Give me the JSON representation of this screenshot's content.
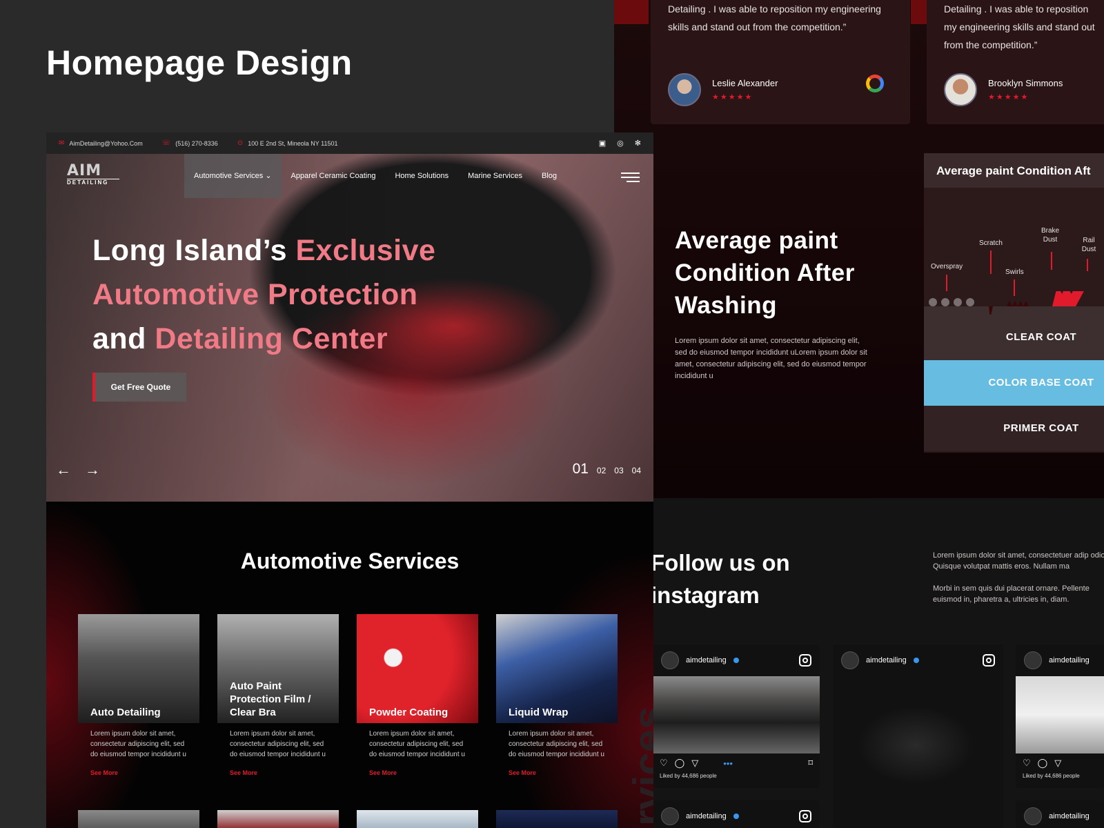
{
  "page_title": "Homepage Design",
  "testimonials": [
    {
      "quote": "Detailing . I was able to reposition my engineering skills and stand out from the competition.”",
      "name": "Leslie Alexander",
      "stars": "★★★★★"
    },
    {
      "quote": "Detailing . I was able to reposition my engineering skills and stand out from the competition.”",
      "name": "Brooklyn Simmons",
      "stars": "★★★★★"
    }
  ],
  "topbar": {
    "email": "AimDetailing@Yohoo.Com",
    "phone": "(516) 270-8336",
    "address": "100 E 2nd St, Mineola NY 11501"
  },
  "nav": {
    "logo_top": "AIM",
    "logo_bottom": "DETAILING",
    "items": [
      "Automotive Services",
      "Apparel Ceramic Coating",
      "Home Solutions",
      "Marine Services",
      "Blog"
    ]
  },
  "hero": {
    "line1_white": "Long Island’s ",
    "line1_pink": "Exclusive",
    "line2_pink": "Automotive Protection",
    "line3_white": "and ",
    "line3_pink": "Detailing Center",
    "cta": "Get Free Quote",
    "slides": [
      "01",
      "02",
      "03",
      "04"
    ]
  },
  "services": {
    "title": "Automotive Services",
    "vertical_text": "rvices",
    "cards": [
      {
        "name": "Auto Detailing",
        "desc": "Lorem ipsum dolor sit amet, consectetur adipiscing elit, sed do eiusmod tempor incididunt u",
        "more": "See More"
      },
      {
        "name": "Auto Paint Protection Film / Clear Bra",
        "desc": "Lorem ipsum dolor sit amet, consectetur adipiscing elit, sed do eiusmod tempor incididunt u",
        "more": "See More"
      },
      {
        "name": "Powder Coating",
        "desc": "Lorem ipsum dolor sit amet, consectetur adipiscing elit, sed do eiusmod tempor incididunt u",
        "more": "See More"
      },
      {
        "name": "Liquid Wrap",
        "desc": "Lorem ipsum dolor sit amet, consectetur adipiscing elit, sed do eiusmod tempor incididunt u",
        "more": "See More"
      }
    ]
  },
  "paint": {
    "title": "Average paint Condition After Washing",
    "desc": "Lorem ipsum dolor sit amet, consectetur adipiscing elit, sed do eiusmod tempor incididunt uLorem ipsum dolor sit amet, consectetur adipiscing elit, sed do eiusmod tempor incididunt u",
    "diagram_header": "Average paint  Condition  Aft",
    "labels": {
      "overspray": "Overspray",
      "scratch": "Scratch",
      "swirls": "Swirls",
      "brake": "Brake Dust",
      "rail": "Rail Dust"
    },
    "layers": {
      "clear": "CLEAR COAT",
      "color": "COLOR BASE COAT",
      "primer": "PRIMER COAT"
    }
  },
  "instagram": {
    "title": "Follow us on instagram",
    "desc1": "Lorem ipsum dolor sit amet, consectetuer adip odio. Quisque volutpat mattis eros. Nullam ma",
    "desc2": "Morbi in sem quis dui placerat ornare. Pellente euismod in, pharetra a, ultricies in, diam.",
    "handle": "aimdetailing",
    "liked": "Liked by 44,686 people"
  },
  "colors": {
    "accent": "#e21b2c",
    "highlight": "#f07a86",
    "base_coat": "#66bde1"
  }
}
